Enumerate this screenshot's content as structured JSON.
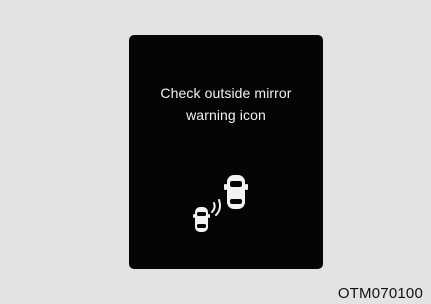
{
  "panel": {
    "message_line1": "Check outside mirror",
    "message_line2": "warning icon",
    "icon": "blind-spot-warning-icon"
  },
  "caption": "OTM070100",
  "colors": {
    "page_background": "#e3e3e3",
    "panel_background": "#050505",
    "panel_text": "#f2f2f2",
    "caption_text": "#111111"
  }
}
